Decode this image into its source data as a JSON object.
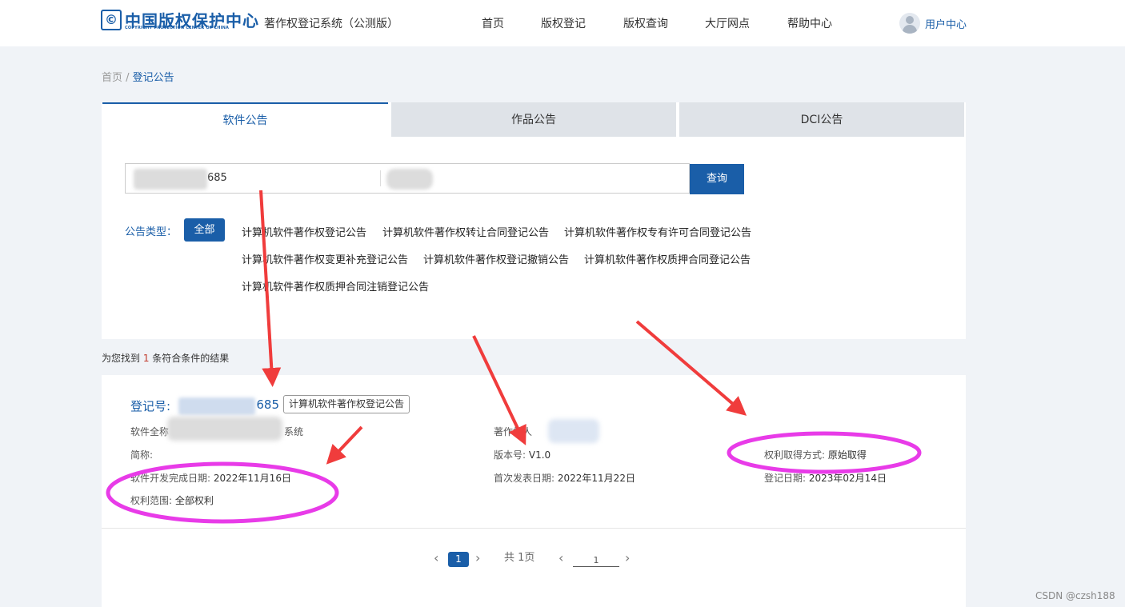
{
  "header": {
    "logo_cn": "中国版权保护中心",
    "logo_en": "COPYRIGHT PROTECTION CENTER OF CHINA",
    "logo_mark": "©",
    "system_name": "著作权登记系统（公测版）",
    "nav": [
      "首页",
      "版权登记",
      "版权查询",
      "大厅网点",
      "帮助中心"
    ],
    "user_center": "用户中心"
  },
  "breadcrumb": {
    "home": "首页",
    "separator": " / ",
    "current": "登记公告"
  },
  "tabs": [
    {
      "label": "软件公告",
      "active": true
    },
    {
      "label": "作品公告",
      "active": false
    },
    {
      "label": "DCI公告",
      "active": false
    }
  ],
  "search": {
    "field1_value": "685",
    "query_button": "查询"
  },
  "announcement_types": {
    "label": "公告类型：",
    "all": "全部",
    "items": [
      "计算机软件著作权登记公告",
      "计算机软件著作权转让合同登记公告",
      "计算机软件著作权专有许可合同登记公告",
      "计算机软件著作权变更补充登记公告",
      "计算机软件著作权登记撤销公告",
      "计算机软件著作权质押合同登记公告",
      "计算机软件著作权质押合同注销登记公告"
    ]
  },
  "results": {
    "prefix": "为您找到 ",
    "count": "1",
    "suffix": " 条符合条件的结果"
  },
  "record": {
    "reg_label": "登记号:",
    "reg_suffix": "685",
    "badge": "计算机软件著作权登记公告",
    "fullname_label": "软件全称",
    "fullname_suffix": "系统",
    "short_label": "简称:",
    "dev_date_label": "软件开发完成日期:",
    "dev_date": "2022年11月16日",
    "scope_label": "权利范围:",
    "scope": "全部权利",
    "owner_label": "著作权人",
    "version_label": "版本号:",
    "version": "V1.0",
    "publish_label": "首次发表日期:",
    "publish_date": "2022年11月22日",
    "acquire_label": "权利取得方式:",
    "acquire": "原始取得",
    "reg_date_label": "登记日期:",
    "reg_date": "2023年02月14日"
  },
  "pagination": {
    "current": "1",
    "total_text": "共 1页",
    "jump_value": "1"
  },
  "watermark": "CSDN @czsh188",
  "colors": {
    "brand": "#1a5ea8",
    "annotation_arrow": "#f03c3c",
    "annotation_ellipse": "#e83be8"
  }
}
